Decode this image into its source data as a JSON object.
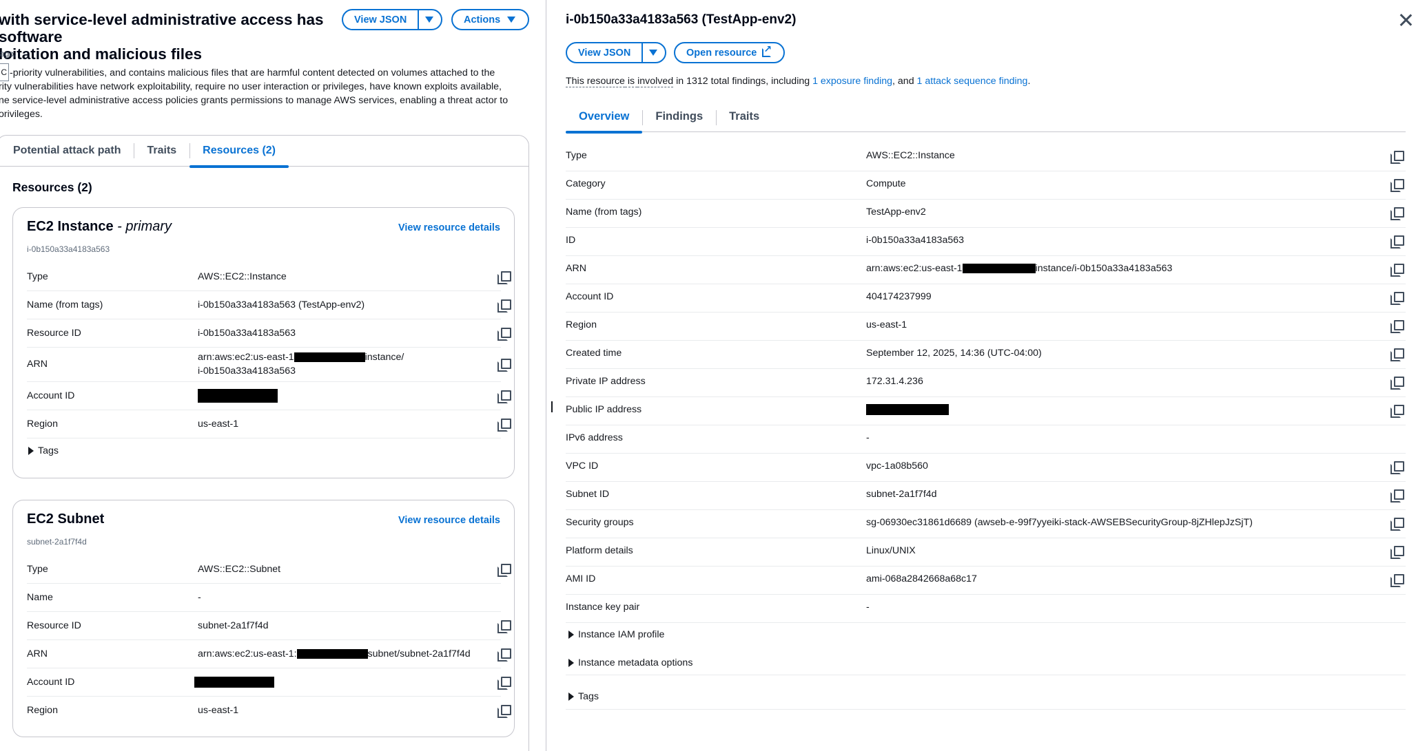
{
  "left": {
    "title": "with service-level administrative access has software exploitation and malicious files",
    "title_line1": "with service-level administrative access has software",
    "title_line2": "loitation and malicious files",
    "view_json": "View JSON",
    "actions": "Actions",
    "ago": "ago.",
    "desc_box": "C",
    "desc_lines": [
      "-priority vulnerabilities, and contains malicious files that are harmful content detected on volumes attached to the",
      "rity vulnerabilities have network exploitability, require no user interaction or privileges, have known exploits available,",
      "ne service-level administrative access policies grants permissions to manage AWS services, enabling a threat actor to",
      "orivileges."
    ],
    "tabs": [
      "Potential attack path",
      "Traits",
      "Resources (2)"
    ],
    "resources_heading": "Resources (2)",
    "cards": [
      {
        "title": "EC2 Instance",
        "title_suffix": "- primary",
        "subtitle": "i-0b150a33a4183a563",
        "link": "View resource details",
        "rows": [
          {
            "k": "Type",
            "v": "AWS::EC2::Instance"
          },
          {
            "k": "Name (from tags)",
            "v": "i-0b150a33a4183a563 (TestApp-env2)"
          },
          {
            "k": "Resource ID",
            "v": "i-0b150a33a4183a563"
          },
          {
            "k": "ARN",
            "v1a": "arn:aws:ec2:us-east-1",
            "v1b": "instance/",
            "v2": "i-0b150a33a4183a563"
          },
          {
            "k": "Account ID",
            "v": ""
          },
          {
            "k": "Region",
            "v": "us-east-1"
          }
        ],
        "expander": "Tags"
      },
      {
        "title": "EC2 Subnet",
        "subtitle": "subnet-2a1f7f4d",
        "link": "View resource details",
        "rows": [
          {
            "k": "Type",
            "v": "AWS::EC2::Subnet"
          },
          {
            "k": "Name",
            "v": "-"
          },
          {
            "k": "Resource ID",
            "v": "subnet-2a1f7f4d"
          },
          {
            "k": "ARN",
            "va": "arn:aws:ec2:us-east-1:",
            "vb": "subnet/subnet-2a1f7f4d"
          },
          {
            "k": "Account ID",
            "v": ""
          },
          {
            "k": "Region",
            "v": "us-east-1"
          }
        ]
      }
    ]
  },
  "right": {
    "title": "i-0b150a33a4183a563 (TestApp-env2)",
    "view_json": "View JSON",
    "open_resource": "Open resource",
    "involve_pre": "This resource",
    "involve_mid1": " is ",
    "involve_dotted": "involved",
    "involve_mid2": " in 1312 total findings, including ",
    "exposure_link": "1 exposure finding",
    "involve_mid3": ", and ",
    "attack_link": "1 attack sequence finding",
    "involve_end": ".",
    "tabs": [
      "Overview",
      "Findings",
      "Traits"
    ],
    "rows": [
      {
        "k": "Type",
        "v": "AWS::EC2::Instance",
        "copy": true
      },
      {
        "k": "Category",
        "v": "Compute",
        "copy": true
      },
      {
        "k": "Name (from tags)",
        "v": "TestApp-env2",
        "copy": true
      },
      {
        "k": "ID",
        "v": "i-0b150a33a4183a563",
        "copy": true
      },
      {
        "k": "ARN",
        "va": "arn:aws:ec2:us-east-1",
        "vb": "instance/i-0b150a33a4183a563",
        "copy": true
      },
      {
        "k": "Account ID",
        "v": "404174237999",
        "copy": true
      },
      {
        "k": "Region",
        "v": "us-east-1",
        "copy": true
      },
      {
        "k": "Created time",
        "v": "September 12, 2025, 14:36 (UTC-04:00)",
        "copy": true
      },
      {
        "k": "Private IP address",
        "v": "172.31.4.236",
        "copy": true
      },
      {
        "k": "Public IP address",
        "v": "",
        "copy": true
      },
      {
        "k": "IPv6 address",
        "v": "-",
        "copy": false
      },
      {
        "k": "VPC ID",
        "v": "vpc-1a08b560",
        "copy": true
      },
      {
        "k": "Subnet ID",
        "v": "subnet-2a1f7f4d",
        "copy": true
      },
      {
        "k": "Security groups",
        "v": "sg-06930ec31861d6689 (awseb-e-99f7yyeiki-stack-AWSEBSecurityGroup-8jZHlepJzSjT)",
        "copy": true
      },
      {
        "k": "Platform details",
        "v": "Linux/UNIX",
        "copy": true
      },
      {
        "k": "AMI ID",
        "v": "ami-068a2842668a68c17",
        "copy": true
      },
      {
        "k": "Instance key pair",
        "v": "-",
        "copy": false
      }
    ],
    "expanders": [
      "Instance IAM profile",
      "Instance metadata options",
      "Tags"
    ]
  }
}
